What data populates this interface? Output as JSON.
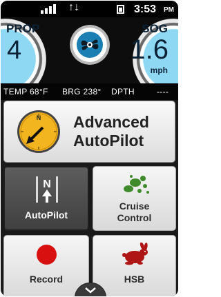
{
  "status": {
    "time": "3:53",
    "ampm": "PM",
    "arrows": "↑↓",
    "signal_icon": "signal-icon",
    "battery_icon": "battery-icon"
  },
  "gauges": {
    "prop": {
      "label": "PROP",
      "value": "4"
    },
    "sog": {
      "label": "SOG",
      "value": "1.6",
      "unit": "mph"
    },
    "center_icon": "propeller-icon"
  },
  "info": {
    "temp": "TEMP 68°F",
    "brg": "BRG 238°",
    "dpth_label": "DPTH",
    "dpth_value": "----"
  },
  "advanced": {
    "title_line1": "Advanced",
    "title_line2": "AutoPilot",
    "compass_letter": "N",
    "icon": "compass-icon"
  },
  "tiles": [
    {
      "label": "AutoPilot",
      "icon": "autopilot-north-icon",
      "letter": "N"
    },
    {
      "label_line1": "Cruise",
      "label_line2": "Control",
      "icon": "cruise-control-icon"
    },
    {
      "label": "Record",
      "icon": "record-icon"
    },
    {
      "label": "HSB",
      "icon": "rabbit-icon"
    }
  ],
  "colors": {
    "accent_blue": "#8fd8f4",
    "record_red": "#d91010",
    "cruise_green": "#3f8a2a",
    "hsb_red": "#b01515",
    "compass_yellow": "#f3b51f"
  }
}
